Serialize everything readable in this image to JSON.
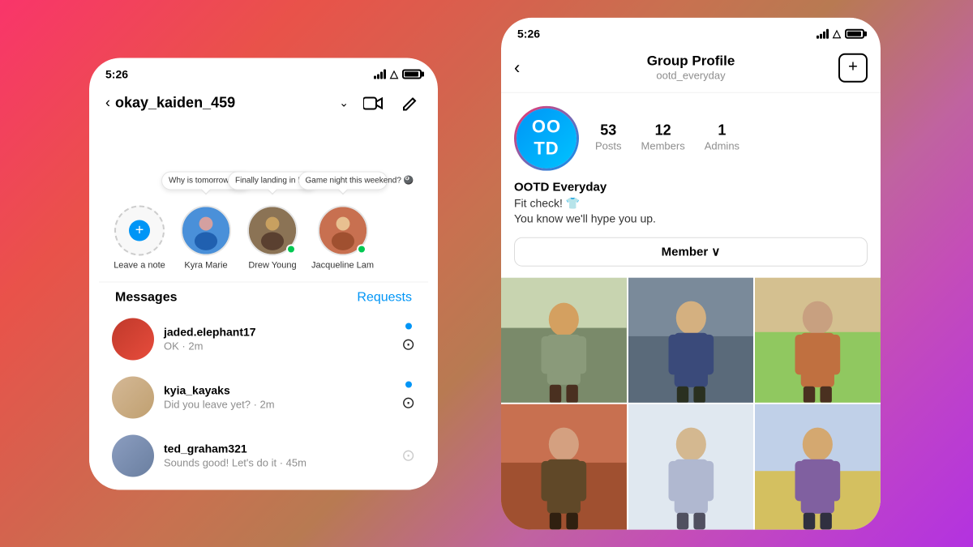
{
  "background": {
    "gradient_start": "#f9356a",
    "gradient_end": "#b332e0"
  },
  "left_phone": {
    "status_bar": {
      "time": "5:26"
    },
    "nav": {
      "back_arrow": "‹",
      "title": "okay_kaiden_459",
      "chevron": "⌄"
    },
    "stories": [
      {
        "id": "self",
        "label": "Leave a note",
        "has_add": true,
        "note": null,
        "online": false
      },
      {
        "id": "kyra",
        "label": "Kyra Marie",
        "has_add": false,
        "note": "Why is tomorrow Monday!? 😩",
        "online": false
      },
      {
        "id": "drew",
        "label": "Drew Young",
        "has_add": false,
        "note": "Finally landing in NYC! ❤️",
        "online": true
      },
      {
        "id": "jacqueline",
        "label": "Jacqueline Lam",
        "has_add": false,
        "note": "Game night this weekend? 🎱",
        "online": true
      }
    ],
    "messages_header": {
      "title": "Messages",
      "requests": "Requests"
    },
    "messages": [
      {
        "username": "jaded.elephant17",
        "preview": "OK · 2m",
        "unread": true,
        "avatar_class": "msg-avatar-1"
      },
      {
        "username": "kyia_kayaks",
        "preview": "Did you leave yet? · 2m",
        "unread": true,
        "avatar_class": "msg-avatar-2"
      },
      {
        "username": "ted_graham321",
        "preview": "Sounds good! Let's do it · 45m",
        "unread": false,
        "avatar_class": "msg-avatar-3"
      }
    ]
  },
  "right_phone": {
    "status_bar": {
      "time": "5:26"
    },
    "nav": {
      "back_arrow": "‹",
      "title": "Group Profile",
      "subtitle": "ootd_everyday",
      "add_icon": "+"
    },
    "group": {
      "avatar_text": "OO\nTD",
      "stats": [
        {
          "num": "53",
          "label": "Posts"
        },
        {
          "num": "12",
          "label": "Members"
        },
        {
          "num": "1",
          "label": "Admins"
        }
      ],
      "name": "OOTD Everyday",
      "desc_line1": "Fit check! 👕",
      "desc_line2": "You know we'll hype you up.",
      "member_button": "Member ∨"
    },
    "grid_photos": [
      {
        "id": 1,
        "alt": "fashion photo 1"
      },
      {
        "id": 2,
        "alt": "fashion photo 2"
      },
      {
        "id": 3,
        "alt": "fashion photo 3"
      },
      {
        "id": 4,
        "alt": "fashion photo 4"
      },
      {
        "id": 5,
        "alt": "fashion photo 5"
      },
      {
        "id": 6,
        "alt": "fashion photo 6"
      }
    ]
  }
}
